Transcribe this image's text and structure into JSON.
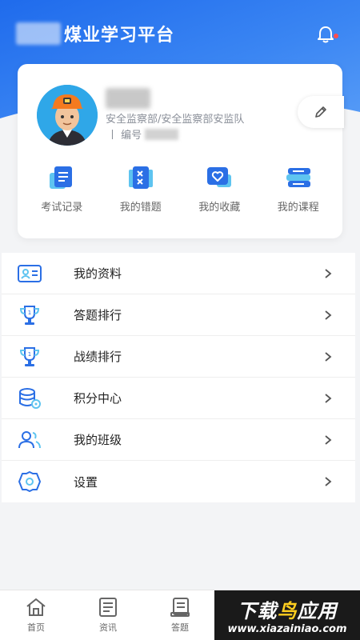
{
  "header": {
    "app_title": "煤业学习平台",
    "bell_icon": "bell-icon"
  },
  "profile": {
    "department": "安全监察部/安全监察部安监队",
    "employee_no_label": "丨 编号",
    "edit_icon": "pencil-icon"
  },
  "quick_actions": [
    {
      "label": "考试记录",
      "icon": "exam-record-icon"
    },
    {
      "label": "我的错题",
      "icon": "wrong-questions-icon"
    },
    {
      "label": "我的收藏",
      "icon": "favorites-icon"
    },
    {
      "label": "我的课程",
      "icon": "courses-icon"
    }
  ],
  "menu": [
    {
      "label": "我的资料",
      "icon": "id-card-icon"
    },
    {
      "label": "答题排行",
      "icon": "trophy-icon"
    },
    {
      "label": "战绩排行",
      "icon": "trophy-icon"
    },
    {
      "label": "积分中心",
      "icon": "coins-icon"
    },
    {
      "label": "我的班级",
      "icon": "users-icon"
    },
    {
      "label": "设置",
      "icon": "settings-icon"
    }
  ],
  "tabbar": [
    {
      "label": "首页",
      "icon": "home-icon"
    },
    {
      "label": "资讯",
      "icon": "news-icon"
    },
    {
      "label": "答题",
      "icon": "answer-icon"
    }
  ],
  "watermark": {
    "cn_part1": "下载",
    "cn_part2": "鸟",
    "cn_part3": "应用",
    "en": "www.xiazainiao.com"
  },
  "colors": {
    "primary": "#1f6bec",
    "accent_light": "#5ec4f0",
    "badge_red": "#ff4d4f"
  }
}
